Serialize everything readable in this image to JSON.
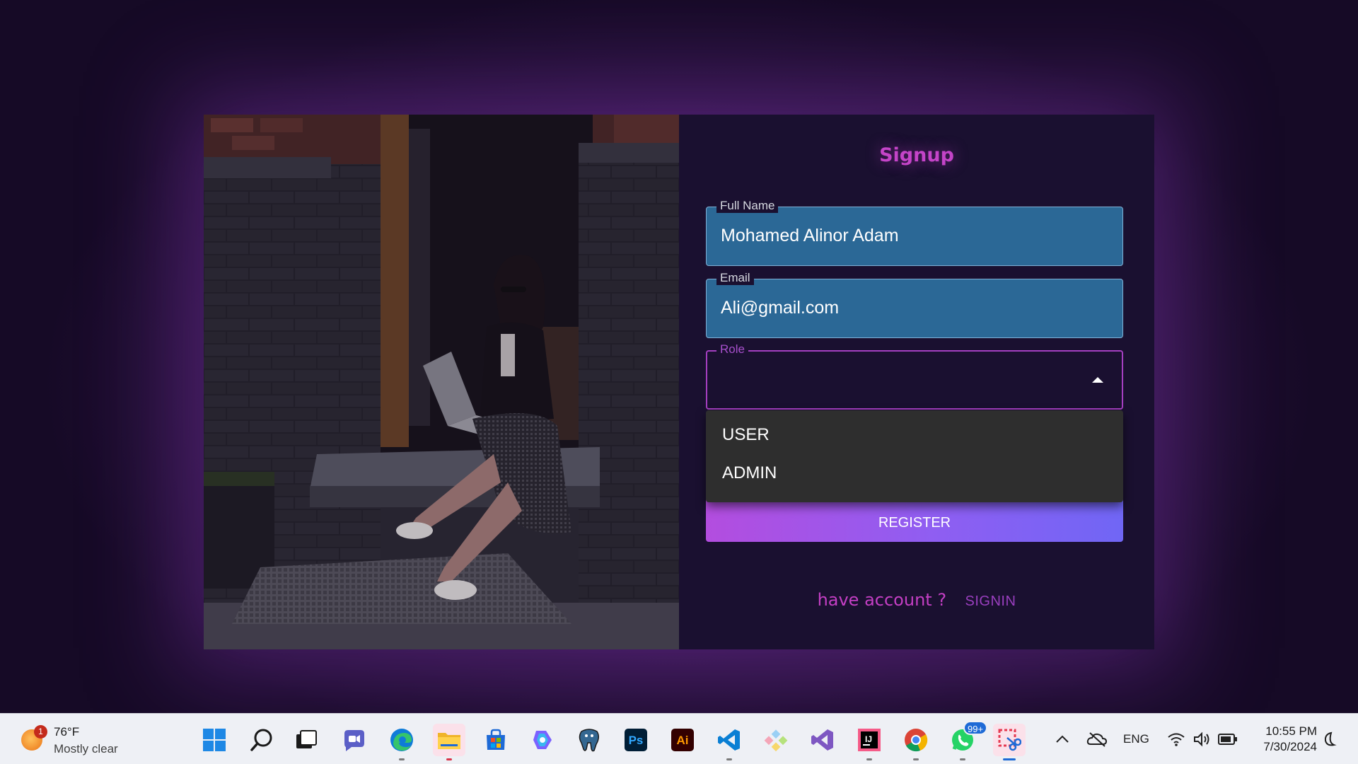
{
  "form": {
    "title": "Signup",
    "fullname": {
      "label": "Full Name",
      "value": "Mohamed Alinor Adam"
    },
    "email": {
      "label": "Email",
      "value": "Ali@gmail.com"
    },
    "role": {
      "label": "Role",
      "value": "",
      "options": [
        "USER",
        "ADMIN"
      ],
      "open": true
    },
    "register_label": "REGISTER",
    "have_account": "have account ?",
    "signin_label": "SIGNIN"
  },
  "colors": {
    "title": "#c444c8",
    "field_bg": "#2b6896",
    "select_border": "#a53fc1",
    "button_gradient_start": "#b34ddf",
    "button_gradient_end": "#7066f5",
    "panel_bg": "#1a1030"
  },
  "taskbar": {
    "weather": {
      "badge": "1",
      "temperature": "76°F",
      "condition": "Mostly clear",
      "icon": "weather-sun-moon-icon"
    },
    "apps": [
      {
        "name": "start-icon"
      },
      {
        "name": "search-icon"
      },
      {
        "name": "task-view-icon"
      },
      {
        "name": "teams-chat-icon"
      },
      {
        "name": "edge-icon"
      },
      {
        "name": "file-explorer-icon",
        "active": true
      },
      {
        "name": "microsoft-store-icon"
      },
      {
        "name": "copilot-icon"
      },
      {
        "name": "postgresql-icon"
      },
      {
        "name": "photoshop-icon",
        "text": "Ps"
      },
      {
        "name": "illustrator-icon",
        "text": "Ai"
      },
      {
        "name": "vscode-icon"
      },
      {
        "name": "pieces-icon"
      },
      {
        "name": "visual-studio-icon"
      },
      {
        "name": "intellij-icon",
        "text": "IJ"
      },
      {
        "name": "chrome-icon"
      },
      {
        "name": "whatsapp-icon",
        "badge": "99+"
      },
      {
        "name": "snipping-tool-icon",
        "current": true
      }
    ],
    "tray": {
      "language": "ENG"
    },
    "clock": {
      "time": "10:55 PM",
      "date": "7/30/2024"
    }
  }
}
